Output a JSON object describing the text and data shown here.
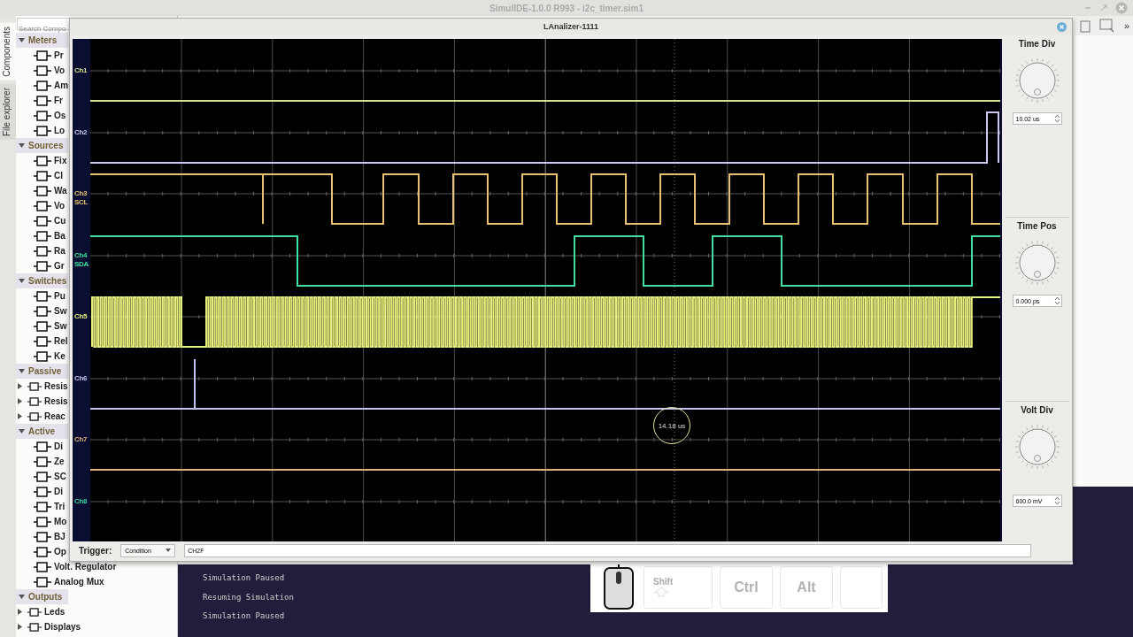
{
  "app": {
    "title": "SimulIDE-1.0.0 R993 - i2c_timer.sim1",
    "toolbar_more": "»"
  },
  "side_tabs": [
    {
      "label": "Components",
      "selected": true
    },
    {
      "label": "File explorer",
      "selected": false
    }
  ],
  "search": {
    "placeholder": "Search Compo"
  },
  "categories": [
    {
      "label": "Meters",
      "expanded": true,
      "children": [
        {
          "label": "Pr",
          "kind": "leaf"
        },
        {
          "label": "Vo",
          "kind": "leaf"
        },
        {
          "label": "Am",
          "kind": "leaf"
        },
        {
          "label": "Fr",
          "kind": "leaf"
        },
        {
          "label": "Os",
          "kind": "leaf"
        },
        {
          "label": "Lo",
          "kind": "leaf"
        }
      ]
    },
    {
      "label": "Sources",
      "expanded": true,
      "children": [
        {
          "label": "Fix",
          "kind": "leaf"
        },
        {
          "label": "Cl",
          "kind": "leaf"
        },
        {
          "label": "Wa",
          "kind": "leaf"
        },
        {
          "label": "Vo",
          "kind": "leaf"
        },
        {
          "label": "Cu",
          "kind": "leaf"
        },
        {
          "label": "Ba",
          "kind": "leaf"
        },
        {
          "label": "Ra",
          "kind": "leaf"
        },
        {
          "label": "Gr",
          "kind": "leaf"
        }
      ]
    },
    {
      "label": "Switches",
      "expanded": true,
      "children": [
        {
          "label": "Pu",
          "kind": "leaf"
        },
        {
          "label": "Sw",
          "kind": "leaf"
        },
        {
          "label": "Sw",
          "kind": "leaf"
        },
        {
          "label": "Rel",
          "kind": "leaf"
        },
        {
          "label": "Ke",
          "kind": "leaf"
        }
      ]
    },
    {
      "label": "Passive",
      "expanded": true,
      "children": [
        {
          "label": "Resis",
          "kind": "folder",
          "expanded": false
        },
        {
          "label": "Resis",
          "kind": "folder",
          "expanded": false
        },
        {
          "label": "Reac",
          "kind": "folder",
          "expanded": false
        }
      ]
    },
    {
      "label": "Active",
      "expanded": true,
      "children": [
        {
          "label": "Di",
          "kind": "leaf"
        },
        {
          "label": "Ze",
          "kind": "leaf"
        },
        {
          "label": "SC",
          "kind": "leaf"
        },
        {
          "label": "Di",
          "kind": "leaf"
        },
        {
          "label": "Tri",
          "kind": "leaf"
        },
        {
          "label": "Mo",
          "kind": "leaf"
        },
        {
          "label": "BJ",
          "kind": "leaf"
        },
        {
          "label": "Op",
          "kind": "leaf"
        },
        {
          "label": "Volt. Regulator",
          "kind": "leaf"
        },
        {
          "label": "Analog Mux",
          "kind": "leaf"
        }
      ]
    },
    {
      "label": "Outputs",
      "expanded": true,
      "children": [
        {
          "label": "Leds",
          "kind": "folder",
          "expanded": false
        },
        {
          "label": "Displays",
          "kind": "folder",
          "expanded": false
        }
      ]
    }
  ],
  "analyzer": {
    "title": "LAnalizer-1111",
    "channels": [
      {
        "label": "Ch1",
        "color": "#d6df8c",
        "kind": "flat"
      },
      {
        "label": "Ch2",
        "color": "#c9c9f2",
        "kind": "end_pulse"
      },
      {
        "label": "Ch3",
        "signal": "SCL",
        "color": "#e6c170",
        "kind": "scl"
      },
      {
        "label": "Ch4",
        "signal": "SDA",
        "color": "#3fe0a0",
        "kind": "sda"
      },
      {
        "label": "Ch5",
        "color": "#e6ef7e",
        "kind": "dense"
      },
      {
        "label": "Ch6",
        "color": "#c4c4f0",
        "kind": "spike"
      },
      {
        "label": "Ch7",
        "color": "#e0b07a",
        "kind": "flat"
      },
      {
        "label": "Ch8",
        "color": "#3fd6a0",
        "kind": "empty"
      }
    ],
    "cursor": {
      "reading": "14.18 us"
    },
    "knobs": [
      {
        "title": "Time Div",
        "value": "10.02 us"
      },
      {
        "title": "Time Pos",
        "value": "0.000 ps"
      },
      {
        "title": "Volt Div",
        "value": "600.0 mV"
      }
    ],
    "trigger": {
      "label": "Trigger:",
      "mode": "Condition",
      "condition": "CH2F"
    }
  },
  "console": {
    "lines": [
      "Simulation Paused",
      "Resuming Simulation",
      "Simulation Paused"
    ]
  },
  "keys": [
    {
      "kind": "mouse"
    },
    {
      "kind": "shift",
      "label": "Shift"
    },
    {
      "kind": "key",
      "label": "Ctrl"
    },
    {
      "kind": "key",
      "label": "Alt"
    },
    {
      "kind": "blank"
    }
  ]
}
